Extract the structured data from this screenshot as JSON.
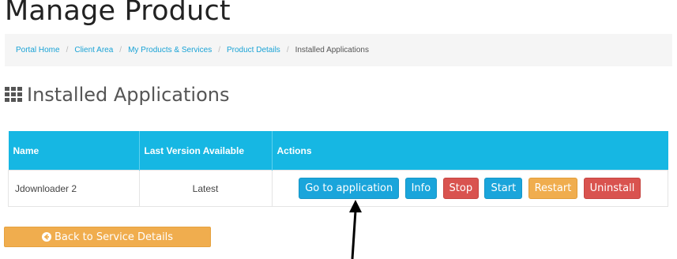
{
  "page": {
    "title": "Manage Product"
  },
  "breadcrumb": {
    "items": [
      "Portal Home",
      "Client Area",
      "My Products & Services",
      "Product Details"
    ],
    "active": "Installed Applications"
  },
  "section": {
    "title": "Installed Applications",
    "icon": "grid-icon"
  },
  "table": {
    "headers": [
      "Name",
      "Last Version Available",
      "Actions"
    ],
    "rows": [
      {
        "name": "Jdownloader 2",
        "version": "Latest"
      }
    ],
    "actions": [
      {
        "label": "Go to application",
        "color": "#1aa5db"
      },
      {
        "label": "Info",
        "color": "#1aa5db"
      },
      {
        "label": "Stop",
        "color": "#d9534f"
      },
      {
        "label": "Start",
        "color": "#1aa5db"
      },
      {
        "label": "Restart",
        "color": "#f0ad4e"
      },
      {
        "label": "Uninstall",
        "color": "#d9534f"
      }
    ]
  },
  "footer": {
    "back_label": "Back to Service Details",
    "back_icon": "circle-arrow-left-icon"
  },
  "colors": {
    "accent": "#16b7e3",
    "danger": "#d9534f",
    "warning": "#f0ad4e",
    "link": "#1aa3d6"
  }
}
